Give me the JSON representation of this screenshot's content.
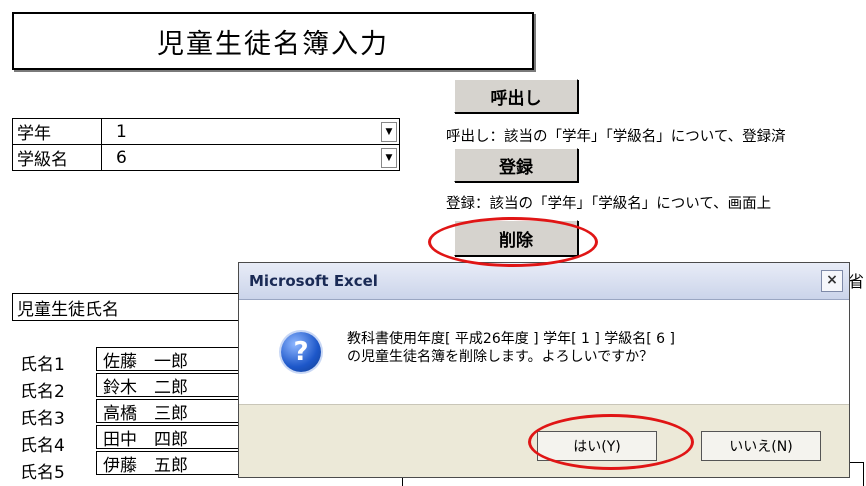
{
  "title": "児童生徒名簿入力",
  "buttons": {
    "call": "呼出し",
    "register": "登録",
    "delete": "削除"
  },
  "descriptions": {
    "call": "呼出し：該当の「学年」「学級名」について、登録済",
    "register": "登録：該当の「学年」「学級名」について、画面上"
  },
  "form": {
    "grade_label": "学年",
    "grade_value": "1",
    "class_label": "学級名",
    "class_value": "6"
  },
  "students": {
    "header": "児童生徒氏名",
    "rows": [
      {
        "label": "氏名1",
        "name": "佐藤　一郎"
      },
      {
        "label": "氏名2",
        "name": "鈴木　二郎"
      },
      {
        "label": "氏名3",
        "name": "高橋　三郎"
      },
      {
        "label": "氏名4",
        "name": "田中　四郎"
      },
      {
        "label": "氏名5",
        "name": "伊藤　五郎"
      }
    ]
  },
  "right_stub": "省",
  "dialog": {
    "title": "Microsoft Excel",
    "message_line1": "教科書使用年度[ 平成26年度 ] 学年[ 1 ] 学級名[ 6 ]",
    "message_line2": "の児童生徒名簿を削除します。よろしいですか？",
    "yes_label": "はい(Y)",
    "no_label": "いいえ(N)",
    "close_glyph": "×"
  },
  "colors": {
    "highlight": "#e01515",
    "button_face": "#d6d3ce"
  },
  "icons": {
    "dialog_icon": "question-icon",
    "dropdown": "dropdown-arrow-icon"
  }
}
